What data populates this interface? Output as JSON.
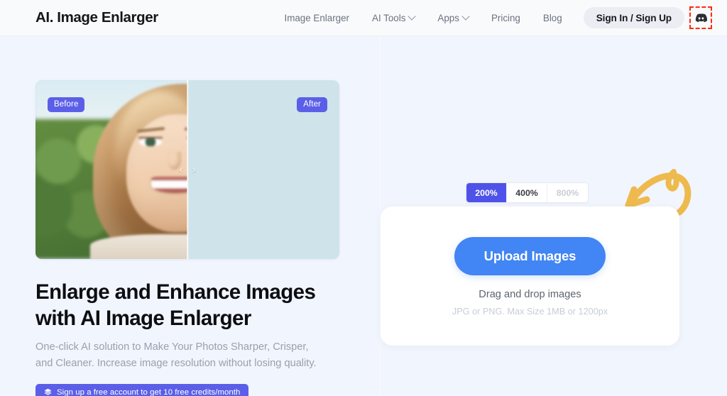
{
  "header": {
    "logo": "AI. Image Enlarger",
    "nav": [
      {
        "label": "Image Enlarger",
        "has_dropdown": false
      },
      {
        "label": "AI Tools",
        "has_dropdown": true
      },
      {
        "label": "Apps",
        "has_dropdown": true
      },
      {
        "label": "Pricing",
        "has_dropdown": false
      },
      {
        "label": "Blog",
        "has_dropdown": false
      }
    ],
    "sign_in_label": "Sign In / Sign Up",
    "discord_icon": "discord-icon",
    "highlight_color": "#ff2a10"
  },
  "hero": {
    "before_badge": "Before",
    "after_badge": "After",
    "slider_left_chevron": "‹",
    "slider_right_chevron": "›",
    "title": "Enlarge and Enhance Images with AI Image Enlarger",
    "subtitle": "One-click AI solution to Make Your Photos Sharper, Crisper, and Cleaner. Increase image resolution without losing quality.",
    "cta_label": "Sign up a free account to get 10 free credits/month",
    "cta_icon": "layers-stack-icon",
    "accent_color": "#5b5fe8"
  },
  "upload": {
    "scale_options": [
      {
        "label": "200%",
        "state": "active"
      },
      {
        "label": "400%",
        "state": "default"
      },
      {
        "label": "800%",
        "state": "disabled"
      }
    ],
    "upload_button_label": "Upload Images",
    "drag_text": "Drag and drop images",
    "hint_text": "JPG or PNG. Max Size 1MB or 1200px",
    "arrow_icon": "curved-arrow-icon",
    "arrow_color": "#eeba4e",
    "button_color": "#4285f4",
    "active_scale_color": "#4f52e8"
  },
  "page": {
    "background_color": "#f1f5fd",
    "header_background": "#f9fafc"
  }
}
